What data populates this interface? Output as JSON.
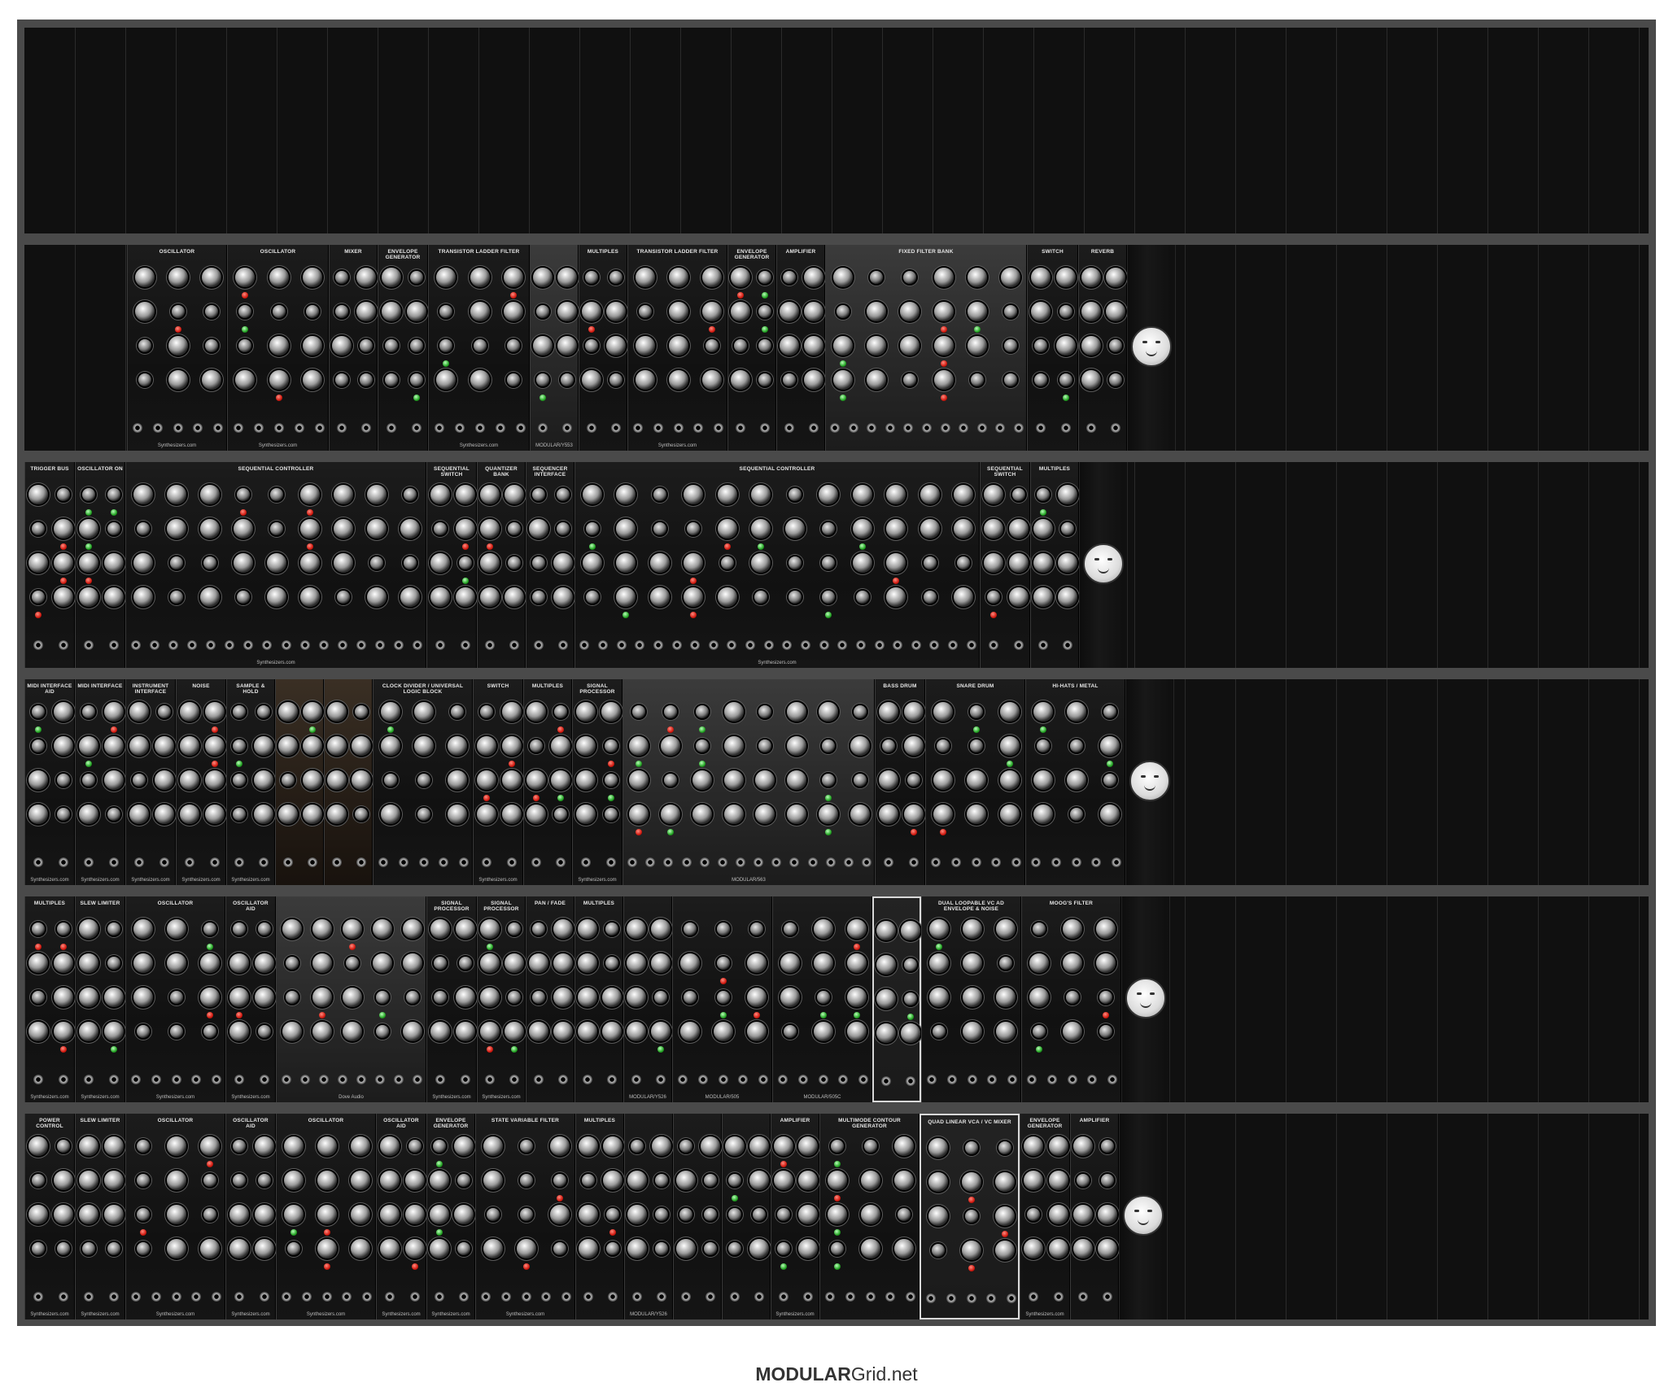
{
  "footer": {
    "brand_bold": "MODULAR",
    "brand_rest": "Grid.net"
  },
  "rows": [
    {
      "modules": []
    },
    {
      "modules": [
        {
          "name": "OSCILLATOR",
          "brand": "Synthesizers.com"
        },
        {
          "name": "OSCILLATOR",
          "brand": "Synthesizers.com"
        },
        {
          "name": "MIXER",
          "brand": ""
        },
        {
          "name": "ENVELOPE GENERATOR",
          "brand": ""
        },
        {
          "name": "TRANSISTOR LADDER FILTER",
          "brand": "Synthesizers.com"
        },
        {
          "name": "",
          "brand": "MODULAR/Y553"
        },
        {
          "name": "MULTIPLES",
          "brand": ""
        },
        {
          "name": "TRANSISTOR LADDER FILTER",
          "brand": "Synthesizers.com"
        },
        {
          "name": "ENVELOPE GENERATOR",
          "brand": ""
        },
        {
          "name": "AMPLIFIER",
          "brand": ""
        },
        {
          "name": "FIXED FILTER BANK",
          "brand": ""
        },
        {
          "name": "SWITCH",
          "brand": ""
        },
        {
          "name": "REVERB",
          "brand": ""
        }
      ]
    },
    {
      "modules": [
        {
          "name": "TRIGGER BUS",
          "brand": ""
        },
        {
          "name": "OSCILLATOR ON",
          "brand": ""
        },
        {
          "name": "SEQUENTIAL CONTROLLER",
          "brand": "Synthesizers.com"
        },
        {
          "name": "SEQUENTIAL SWITCH",
          "brand": ""
        },
        {
          "name": "QUANTIZER BANK",
          "brand": ""
        },
        {
          "name": "SEQUENCER INTERFACE",
          "brand": ""
        },
        {
          "name": "SEQUENTIAL CONTROLLER",
          "brand": "Synthesizers.com"
        },
        {
          "name": "SEQUENTIAL SWITCH",
          "brand": ""
        },
        {
          "name": "MULTIPLES",
          "brand": ""
        }
      ]
    },
    {
      "modules": [
        {
          "name": "MIDI INTERFACE AID",
          "brand": "Synthesizers.com"
        },
        {
          "name": "MIDI INTERFACE",
          "brand": "Synthesizers.com"
        },
        {
          "name": "INSTRUMENT INTERFACE",
          "brand": "Synthesizers.com"
        },
        {
          "name": "NOISE",
          "brand": "Synthesizers.com"
        },
        {
          "name": "SAMPLE & HOLD",
          "brand": "Synthesizers.com"
        },
        {
          "name": "",
          "brand": ""
        },
        {
          "name": "",
          "brand": ""
        },
        {
          "name": "CLOCK DIVIDER / UNIVERSAL LOGIC BLOCK",
          "brand": ""
        },
        {
          "name": "SWITCH",
          "brand": "Synthesizers.com"
        },
        {
          "name": "MULTIPLES",
          "brand": ""
        },
        {
          "name": "SIGNAL PROCESSOR",
          "brand": "Synthesizers.com"
        },
        {
          "name": "",
          "brand": "MODULAR/563"
        },
        {
          "name": "BASS DRUM",
          "brand": ""
        },
        {
          "name": "SNARE DRUM",
          "brand": ""
        },
        {
          "name": "HI-HATS / METAL",
          "brand": ""
        }
      ]
    },
    {
      "modules": [
        {
          "name": "MULTIPLES",
          "brand": "Synthesizers.com"
        },
        {
          "name": "SLEW LIMITER",
          "brand": "Synthesizers.com"
        },
        {
          "name": "OSCILLATOR",
          "brand": "Synthesizers.com"
        },
        {
          "name": "OSCILLATOR AID",
          "brand": "Synthesizers.com"
        },
        {
          "name": "",
          "brand": "Dove Audio"
        },
        {
          "name": "SIGNAL PROCESSOR",
          "brand": "Synthesizers.com"
        },
        {
          "name": "SIGNAL PROCESSOR",
          "brand": "Synthesizers.com"
        },
        {
          "name": "PAN / FADE",
          "brand": ""
        },
        {
          "name": "MULTIPLES",
          "brand": ""
        },
        {
          "name": "",
          "brand": "MODULAR/Y526"
        },
        {
          "name": "",
          "brand": "MODULAR/505"
        },
        {
          "name": "",
          "brand": "MODULAR/505C"
        },
        {
          "name": "",
          "brand": ""
        },
        {
          "name": "DUAL LOOPABLE VC AD ENVELOPE & NOISE",
          "brand": ""
        },
        {
          "name": "MOOG'S FILTER",
          "brand": ""
        }
      ]
    },
    {
      "modules": [
        {
          "name": "POWER CONTROL",
          "brand": "Synthesizers.com"
        },
        {
          "name": "SLEW LIMITER",
          "brand": "Synthesizers.com"
        },
        {
          "name": "OSCILLATOR",
          "brand": "Synthesizers.com"
        },
        {
          "name": "OSCILLATOR AID",
          "brand": "Synthesizers.com"
        },
        {
          "name": "OSCILLATOR",
          "brand": "Synthesizers.com"
        },
        {
          "name": "OSCILLATOR AID",
          "brand": "Synthesizers.com"
        },
        {
          "name": "ENVELOPE GENERATOR",
          "brand": "Synthesizers.com"
        },
        {
          "name": "STATE VARIABLE FILTER",
          "brand": "Synthesizers.com"
        },
        {
          "name": "MULTIPLES",
          "brand": ""
        },
        {
          "name": "",
          "brand": "MODULAR/Y526"
        },
        {
          "name": "",
          "brand": ""
        },
        {
          "name": "",
          "brand": ""
        },
        {
          "name": "AMPLIFIER",
          "brand": "Synthesizers.com"
        },
        {
          "name": "MULTIMODE CONTOUR GENERATOR",
          "brand": ""
        },
        {
          "name": "QUAD LINEAR VCA / VC MIXER",
          "brand": ""
        },
        {
          "name": "ENVELOPE GENERATOR",
          "brand": "Synthesizers.com"
        },
        {
          "name": "AMPLIFIER",
          "brand": ""
        }
      ]
    }
  ]
}
